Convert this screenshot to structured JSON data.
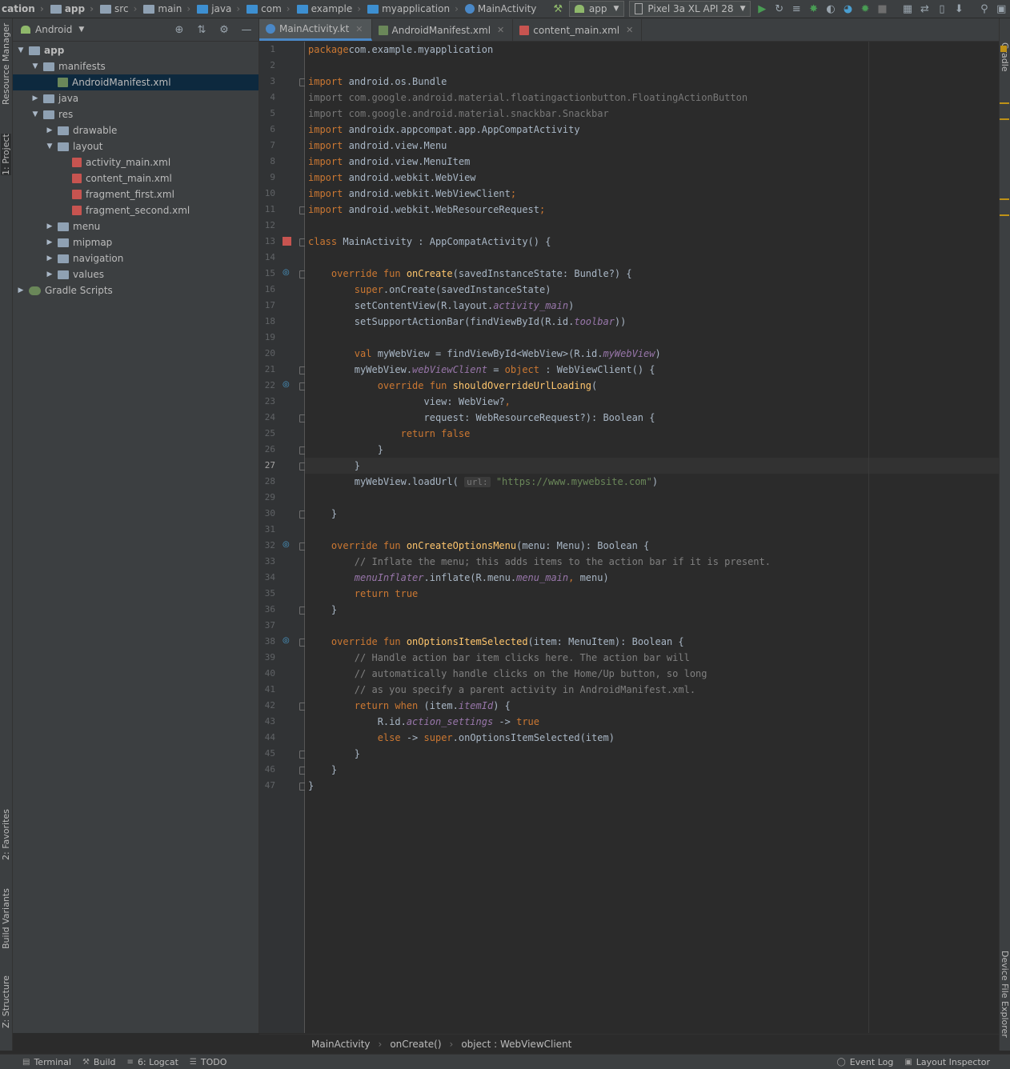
{
  "navbar": {
    "crumbs": [
      "cation",
      "app",
      "src",
      "main",
      "java",
      "com",
      "example",
      "myapplication",
      "MainActivity"
    ],
    "run_config": "app",
    "device": "Pixel 3a XL API 28"
  },
  "left_stripe": [
    "Resource Manager",
    "1: Project",
    "2: Favorites",
    "Build Variants",
    "Z: Structure"
  ],
  "right_stripe": [
    "Gradle",
    "Device File Explorer"
  ],
  "project_panel": {
    "view": "Android",
    "tree": [
      {
        "label": "app",
        "depth": 0,
        "type": "module",
        "expanded": true
      },
      {
        "label": "manifests",
        "depth": 1,
        "type": "folder",
        "expanded": true
      },
      {
        "label": "AndroidManifest.xml",
        "depth": 2,
        "type": "manifest",
        "selected": true
      },
      {
        "label": "java",
        "depth": 1,
        "type": "folder",
        "expanded": false
      },
      {
        "label": "res",
        "depth": 1,
        "type": "folder",
        "expanded": true
      },
      {
        "label": "drawable",
        "depth": 2,
        "type": "folder",
        "expanded": false
      },
      {
        "label": "layout",
        "depth": 2,
        "type": "folder",
        "expanded": true
      },
      {
        "label": "activity_main.xml",
        "depth": 3,
        "type": "xml"
      },
      {
        "label": "content_main.xml",
        "depth": 3,
        "type": "xml"
      },
      {
        "label": "fragment_first.xml",
        "depth": 3,
        "type": "xml"
      },
      {
        "label": "fragment_second.xml",
        "depth": 3,
        "type": "xml"
      },
      {
        "label": "menu",
        "depth": 2,
        "type": "folder",
        "expanded": false
      },
      {
        "label": "mipmap",
        "depth": 2,
        "type": "folder",
        "expanded": false
      },
      {
        "label": "navigation",
        "depth": 2,
        "type": "folder",
        "expanded": false
      },
      {
        "label": "values",
        "depth": 2,
        "type": "folder",
        "expanded": false
      },
      {
        "label": "Gradle Scripts",
        "depth": 0,
        "type": "gradle",
        "expanded": false
      }
    ]
  },
  "tabs": [
    {
      "label": "MainActivity.kt",
      "active": true,
      "type": "kt"
    },
    {
      "label": "AndroidManifest.xml",
      "active": false,
      "type": "manifest"
    },
    {
      "label": "content_main.xml",
      "active": false,
      "type": "xml"
    }
  ],
  "editor": {
    "current_line": 27,
    "lines": [
      [
        [
          "kw",
          "package"
        ],
        [
          "",
          "com.example.myapplication"
        ]
      ],
      [],
      [
        [
          "kw",
          "import"
        ],
        [
          "",
          " android.os.Bundle"
        ]
      ],
      [
        [
          "dim",
          "import com.google.android.material.floatingactionbutton.FloatingActionButton"
        ]
      ],
      [
        [
          "dim",
          "import com.google.android.material.snackbar.Snackbar"
        ]
      ],
      [
        [
          "kw",
          "import"
        ],
        [
          "",
          " androidx.appcompat.app.AppCompatActivity"
        ]
      ],
      [
        [
          "kw",
          "import"
        ],
        [
          "",
          " android.view.Menu"
        ]
      ],
      [
        [
          "kw",
          "import"
        ],
        [
          "",
          " android.view.MenuItem"
        ]
      ],
      [
        [
          "kw",
          "import"
        ],
        [
          "",
          " android.webkit.WebView"
        ]
      ],
      [
        [
          "kw",
          "import"
        ],
        [
          "",
          " android.webkit.WebViewClient"
        ],
        [
          "kw",
          ";"
        ]
      ],
      [
        [
          "kw",
          "import"
        ],
        [
          "",
          " android.webkit.WebResourceRequest"
        ],
        [
          "kw",
          ";"
        ]
      ],
      [],
      [
        [
          "kw",
          "class"
        ],
        [
          "",
          " MainActivity : AppCompatActivity() {"
        ]
      ],
      [],
      [
        [
          "",
          "    "
        ],
        [
          "kw",
          "override fun "
        ],
        [
          "fn",
          "onCreate"
        ],
        [
          "",
          "(savedInstanceState: Bundle?) {"
        ]
      ],
      [
        [
          "",
          "        "
        ],
        [
          "kw",
          "super"
        ],
        [
          "",
          ".onCreate(savedInstanceState)"
        ]
      ],
      [
        [
          "",
          "        setContentView(R.layout."
        ],
        [
          "prop",
          "activity_main"
        ],
        [
          "",
          ")"
        ]
      ],
      [
        [
          "",
          "        setSupportActionBar(findViewById(R.id."
        ],
        [
          "prop",
          "toolbar"
        ],
        [
          "",
          "))"
        ]
      ],
      [],
      [
        [
          "",
          "        "
        ],
        [
          "kw",
          "val "
        ],
        [
          "",
          "myWebView = findViewById<WebView>(R.id."
        ],
        [
          "prop",
          "myWebView"
        ],
        [
          "",
          ")"
        ]
      ],
      [
        [
          "",
          "        myWebView."
        ],
        [
          "prop",
          "webViewClient"
        ],
        [
          "",
          " = "
        ],
        [
          "kw",
          "object"
        ],
        [
          "",
          " : WebViewClient() {"
        ]
      ],
      [
        [
          "",
          "            "
        ],
        [
          "kw",
          "override fun "
        ],
        [
          "fn",
          "shouldOverrideUrlLoading"
        ],
        [
          "",
          "("
        ]
      ],
      [
        [
          "",
          "                    view: WebView?"
        ],
        [
          "kw",
          ","
        ]
      ],
      [
        [
          "",
          "                    request: WebResourceRequest?): Boolean {"
        ]
      ],
      [
        [
          "",
          "                "
        ],
        [
          "kw",
          "return false"
        ]
      ],
      [
        [
          "",
          "            }"
        ]
      ],
      [
        [
          "",
          "        }"
        ]
      ],
      [
        [
          "",
          "        myWebView.loadUrl( "
        ],
        [
          "hint",
          "url:"
        ],
        [
          "",
          " "
        ],
        [
          "str",
          "\"https://www.mywebsite.com\""
        ],
        [
          "",
          ")"
        ]
      ],
      [],
      [
        [
          "",
          "    }"
        ]
      ],
      [],
      [
        [
          "",
          "    "
        ],
        [
          "kw",
          "override fun "
        ],
        [
          "fn",
          "onCreateOptionsMenu"
        ],
        [
          "",
          "(menu: Menu): Boolean {"
        ]
      ],
      [
        [
          "",
          "        "
        ],
        [
          "cmt",
          "// Inflate the menu; this adds items to the action bar if it is present."
        ]
      ],
      [
        [
          "",
          "        "
        ],
        [
          "prop",
          "menuInflater"
        ],
        [
          "",
          ".inflate(R.menu."
        ],
        [
          "prop",
          "menu_main"
        ],
        [
          "kw",
          ","
        ],
        [
          "",
          " menu)"
        ]
      ],
      [
        [
          "",
          "        "
        ],
        [
          "kw",
          "return true"
        ]
      ],
      [
        [
          "",
          "    }"
        ]
      ],
      [],
      [
        [
          "",
          "    "
        ],
        [
          "kw",
          "override fun "
        ],
        [
          "fn",
          "onOptionsItemSelected"
        ],
        [
          "",
          "(item: MenuItem): Boolean {"
        ]
      ],
      [
        [
          "",
          "        "
        ],
        [
          "cmt",
          "// Handle action bar item clicks here. The action bar will"
        ]
      ],
      [
        [
          "",
          "        "
        ],
        [
          "cmt",
          "// automatically handle clicks on the Home/Up button, so long"
        ]
      ],
      [
        [
          "",
          "        "
        ],
        [
          "cmt",
          "// as you specify a parent activity in AndroidManifest.xml."
        ]
      ],
      [
        [
          "",
          "        "
        ],
        [
          "kw",
          "return when "
        ],
        [
          "",
          "(item."
        ],
        [
          "prop",
          "itemId"
        ],
        [
          "",
          ") {"
        ]
      ],
      [
        [
          "",
          "            R.id."
        ],
        [
          "prop",
          "action_settings"
        ],
        [
          "",
          " -> "
        ],
        [
          "kw",
          "true"
        ]
      ],
      [
        [
          "",
          "            "
        ],
        [
          "kw",
          "else "
        ],
        [
          "",
          "-> "
        ],
        [
          "kw",
          "super"
        ],
        [
          "",
          ".onOptionsItemSelected(item)"
        ]
      ],
      [
        [
          "",
          "        }"
        ]
      ],
      [
        [
          "",
          "    }"
        ]
      ],
      [
        [
          "",
          "}"
        ]
      ]
    ]
  },
  "editor_breadcrumb": [
    "MainActivity",
    "onCreate()",
    "object : WebViewClient"
  ],
  "bottom_tools": {
    "left": [
      "Terminal",
      "Build",
      "6: Logcat",
      "TODO"
    ],
    "right": [
      "Event Log",
      "Layout Inspector"
    ]
  },
  "colors": {
    "keyword": "#cc7832",
    "function": "#ffc66d",
    "string": "#6a8759",
    "comment": "#808080",
    "property": "#9876aa",
    "selection": "#0d293e",
    "tab_underline": "#4a88c7"
  }
}
